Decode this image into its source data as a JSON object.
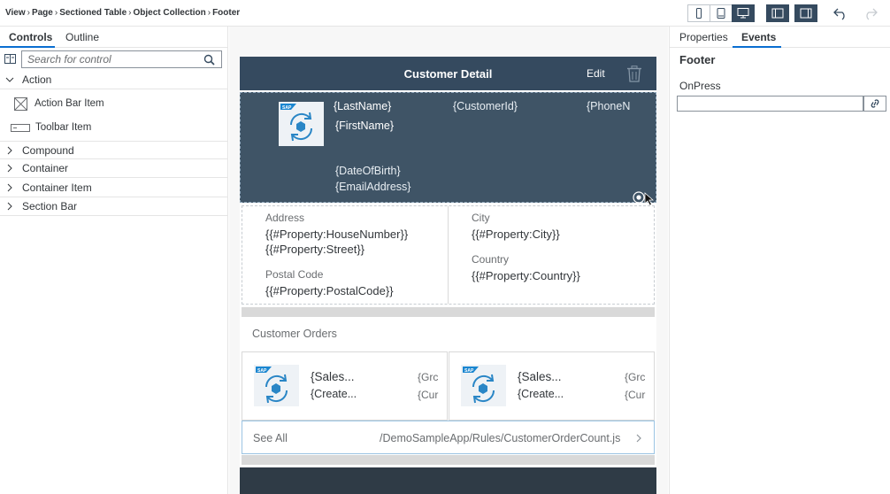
{
  "breadcrumb": [
    "View",
    "Page",
    "Sectioned Table",
    "Object Collection",
    "Footer"
  ],
  "toolbar": {
    "devices": [
      "phone-icon",
      "tablet-icon",
      "desktop-icon"
    ],
    "panels": [
      "left-panel-toggle-icon",
      "right-panel-toggle-icon"
    ],
    "undo": "undo-icon",
    "accent": "#354a5f"
  },
  "left_panel": {
    "tabs": [
      "Controls",
      "Outline"
    ],
    "search_placeholder": "Search for control",
    "tree": [
      {
        "label": "Action",
        "expanded": true,
        "children": [
          {
            "label": "Action Bar Item",
            "icon": "action-bar-item-icon"
          },
          {
            "label": "Toolbar Item",
            "icon": "toolbar-item-icon"
          }
        ]
      },
      {
        "label": "Compound",
        "expanded": false
      },
      {
        "label": "Container",
        "expanded": false
      },
      {
        "label": "Container Item",
        "expanded": false
      },
      {
        "label": "Section Bar",
        "expanded": false
      }
    ]
  },
  "canvas": {
    "nav_title": "Customer Detail",
    "nav_edit": "Edit",
    "header": {
      "last_name": "{LastName}",
      "first_name": "{FirstName}",
      "customer_id": "{CustomerId}",
      "phone": "{PhoneN",
      "dob": "{DateOfBirth}",
      "email": "{EmailAddress}"
    },
    "kv": {
      "address_label": "Address",
      "address_value_1": "{{#Property:HouseNumber}}",
      "address_value_2": "{{#Property:Street}}",
      "postal_label": "Postal Code",
      "postal_value": "{{#Property:PostalCode}}",
      "city_label": "City",
      "city_value": "{{#Property:City}}",
      "country_label": "Country",
      "country_value": "{{#Property:Country}}"
    },
    "orders_title": "Customer Orders",
    "orders": [
      {
        "title": "{Sales...",
        "subtitle": "{Create...",
        "right1": "{Grc",
        "right2": "{Cur"
      },
      {
        "title": "{Sales...",
        "subtitle": "{Create...",
        "right1": "{Grc",
        "right2": "{Cur"
      }
    ],
    "see_all_label": "See All",
    "see_all_value": "/DemoSampleApp/Rules/CustomerOrderCount.js"
  },
  "right_panel": {
    "tabs": [
      "Properties",
      "Events"
    ],
    "title": "Footer",
    "onpress_label": "OnPress",
    "onpress_value": ""
  }
}
